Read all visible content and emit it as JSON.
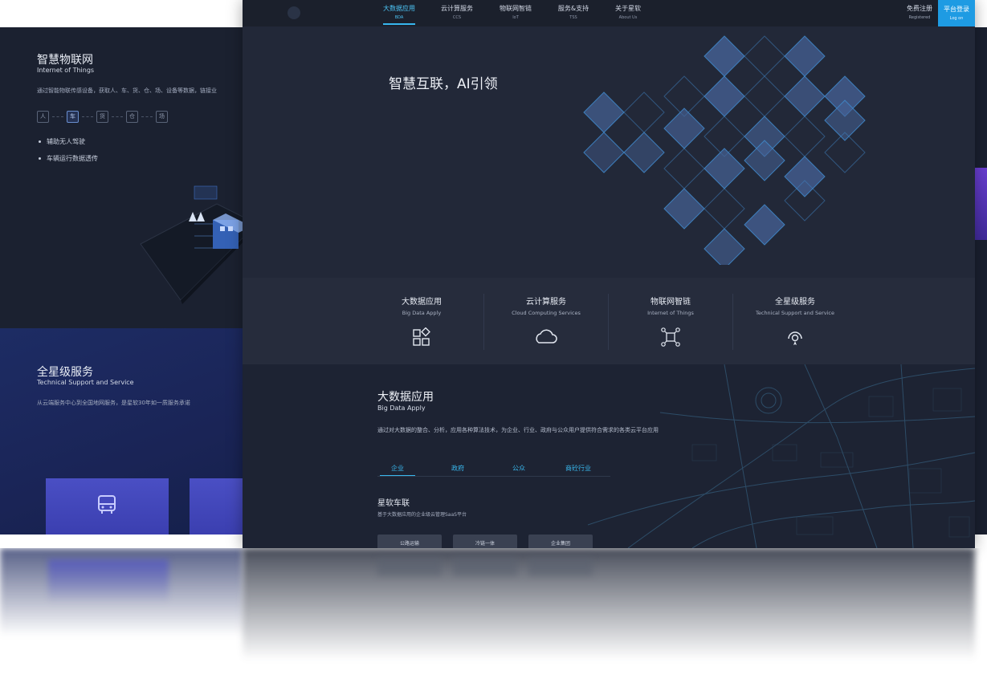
{
  "back_panel": {
    "iot": {
      "title": "智慧物联网",
      "subtitle": "Internet of Things",
      "desc": "通过智能物联传感设备，获取人、车、货、仓、场、设备等数据，链接业",
      "steps": [
        "人",
        "车",
        "货",
        "仓",
        "场"
      ],
      "bullets": [
        "辅助无人驾驶",
        "车辆运行数据透传"
      ]
    },
    "service": {
      "title": "全星级服务",
      "subtitle": "Technical Support and Service",
      "desc": "从云端服务中心到全国地网服务，是星软30年如一质服务承诺"
    }
  },
  "nav": {
    "items": [
      {
        "zh": "大数据应用",
        "en": "BDA"
      },
      {
        "zh": "云计算服务",
        "en": "CCS"
      },
      {
        "zh": "物联网智链",
        "en": "IoT"
      },
      {
        "zh": "服务&支持",
        "en": "TSS"
      },
      {
        "zh": "关于星软",
        "en": "About Us"
      }
    ],
    "register": {
      "zh": "免费注册",
      "en": "Registered"
    },
    "login": {
      "zh": "平台登录",
      "en": "Log on"
    }
  },
  "hero": {
    "title": "智慧互联，AI引领"
  },
  "features": [
    {
      "zh": "大数据应用",
      "en": "Big Data Apply",
      "icon": "apps-icon"
    },
    {
      "zh": "云计算服务",
      "en": "Cloud Computing Services",
      "icon": "cloud-icon"
    },
    {
      "zh": "物联网智链",
      "en": "Internet of Things",
      "icon": "network-icon"
    },
    {
      "zh": "全星级服务",
      "en": "Technical Support and Service",
      "icon": "support-icon"
    }
  ],
  "bigdata": {
    "title": "大数据应用",
    "subtitle": "Big Data Apply",
    "desc": "通过对大数据的整合、分析，应用各种算法技术，为企业、行业、政府与公众用户提供符合需求的各类云平台应用",
    "tabs": [
      "企业",
      "政府",
      "公众",
      "商砼行业"
    ],
    "section_title": "星软车联",
    "section_sub": "基于大数据应用的企业级云管理SaaS平台",
    "pills": [
      "公路运输",
      "冷链一体",
      "企业集团"
    ]
  },
  "colors": {
    "accent": "#1e9be3",
    "tab": "#39b8ee",
    "bg": "#222838"
  }
}
